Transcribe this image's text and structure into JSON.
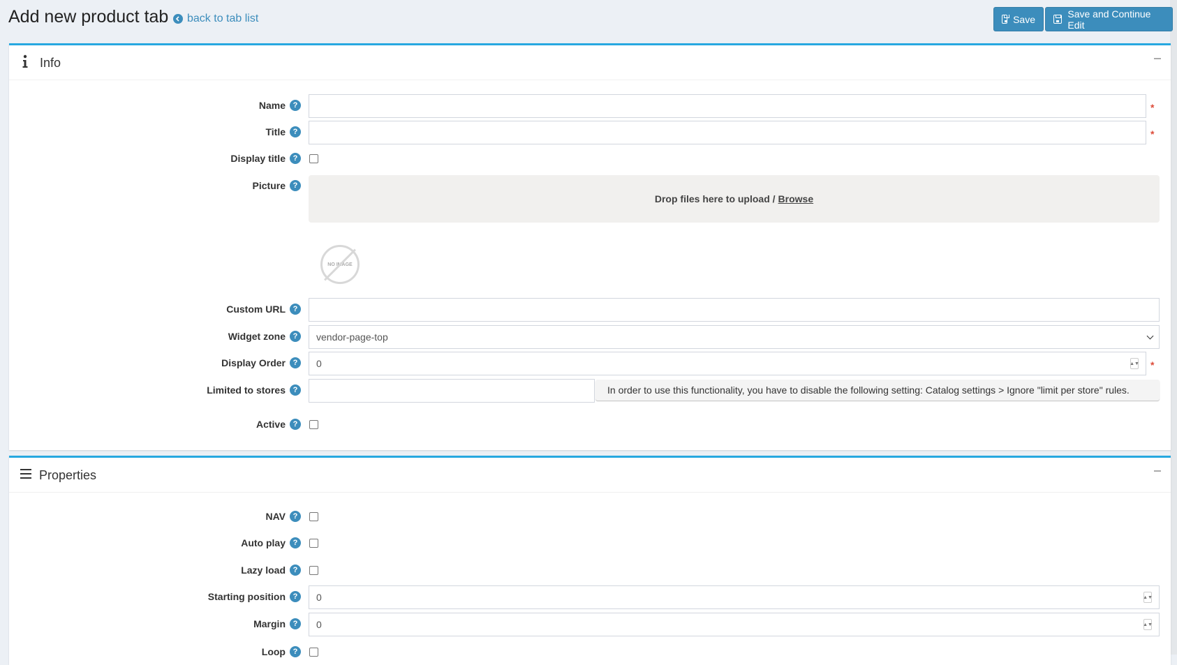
{
  "header": {
    "title": "Add new product tab",
    "back_link": "back to tab list",
    "save_label": "Save",
    "save_continue_label": "Save and Continue Edit"
  },
  "info": {
    "title": "Info",
    "fields": {
      "name": {
        "label": "Name",
        "value": ""
      },
      "title": {
        "label": "Title",
        "value": ""
      },
      "display_title": {
        "label": "Display title",
        "checked": false
      },
      "picture": {
        "label": "Picture",
        "drop_text": "Drop files here to upload /",
        "browse": "Browse",
        "no_image": "NO IMAGE"
      },
      "custom_url": {
        "label": "Custom URL",
        "value": ""
      },
      "widget_zone": {
        "label": "Widget zone",
        "value": "vendor-page-top"
      },
      "display_order": {
        "label": "Display Order",
        "value": "0"
      },
      "limited_to_stores": {
        "label": "Limited to stores",
        "value": "",
        "notice": "In order to use this functionality, you have to disable the following setting: Catalog settings > Ignore \"limit per store\" rules."
      },
      "active": {
        "label": "Active",
        "checked": false
      }
    }
  },
  "properties": {
    "title": "Properties",
    "fields": {
      "nav": {
        "label": "NAV",
        "checked": false
      },
      "auto_play": {
        "label": "Auto play",
        "checked": false
      },
      "lazy_load": {
        "label": "Lazy load",
        "checked": false
      },
      "starting_position": {
        "label": "Starting position",
        "value": "0"
      },
      "margin": {
        "label": "Margin",
        "value": "0"
      },
      "loop": {
        "label": "Loop",
        "checked": false
      }
    }
  },
  "colors": {
    "accent": "#3c8dbc",
    "card_border": "#27a8e0",
    "required": "#dd4b39"
  },
  "icons": [
    "arrow-left-circle-icon",
    "floppy-disk-icon",
    "info-icon",
    "bars-icon",
    "help-icon",
    "chevron-down-icon",
    "spinner-icon",
    "no-image-icon",
    "minus-icon"
  ]
}
